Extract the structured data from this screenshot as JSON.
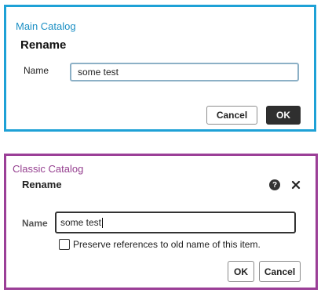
{
  "main_catalog": {
    "label": "Main Catalog",
    "dialog_title": "Rename",
    "name_label": "Name",
    "name_value": "some test",
    "cancel_label": "Cancel",
    "ok_label": "OK",
    "border_color": "#1ea1d6"
  },
  "classic_catalog": {
    "label": "Classic Catalog",
    "dialog_title": "Rename",
    "help_icon": "question-mark-circle",
    "help_glyph": "?",
    "close_icon": "close-x",
    "name_label": "Name",
    "name_value": "some test",
    "checkbox_label": "Preserve references to old name of this item.",
    "checkbox_checked": false,
    "ok_label": "OK",
    "cancel_label": "Cancel",
    "border_color": "#9b3f97"
  }
}
